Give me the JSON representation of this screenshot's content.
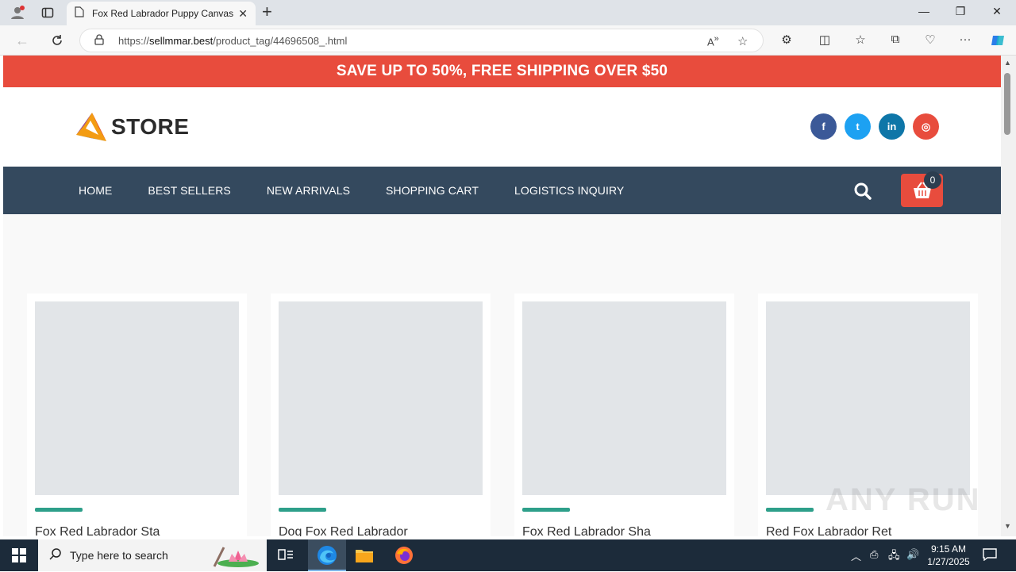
{
  "browser": {
    "tab_title": "Fox Red Labrador Puppy Canvas",
    "url_prefix": "https://",
    "url_domain": "sellmmar.best",
    "url_path": "/product_tag/44696508_.html"
  },
  "promo": {
    "text": "SAVE UP TO 50%, FREE SHIPPING OVER $50"
  },
  "header": {
    "logo_text": "STORE",
    "socials": [
      {
        "icon": "facebook-icon",
        "glyph": "f",
        "color": "#3b5998"
      },
      {
        "icon": "twitter-icon",
        "glyph": "t",
        "color": "#1da1f2"
      },
      {
        "icon": "linkedin-icon",
        "glyph": "in",
        "color": "#0e76a8"
      },
      {
        "icon": "instagram-icon",
        "glyph": "◎",
        "color": "#e84c3d"
      }
    ]
  },
  "menu": {
    "items": [
      "HOME",
      "BEST SELLERS",
      "NEW ARRIVALS",
      "SHOPPING CART",
      "LOGISTICS INQUIRY"
    ],
    "cart_count": "0"
  },
  "products": [
    {
      "title": "Fox Red Labrador Sta"
    },
    {
      "title": "Dog Fox Red Labrador"
    },
    {
      "title": "Fox Red Labrador Sha"
    },
    {
      "title": "Red Fox Labrador Ret"
    }
  ],
  "watermark": "ANY RUN",
  "taskbar": {
    "search_placeholder": "Type here to search",
    "time": "9:15 AM",
    "date": "1/27/2025"
  },
  "colors": {
    "promo_bg": "#e84c3d",
    "menu_bg": "#34495e",
    "accent_bar": "#2e9f8a"
  }
}
